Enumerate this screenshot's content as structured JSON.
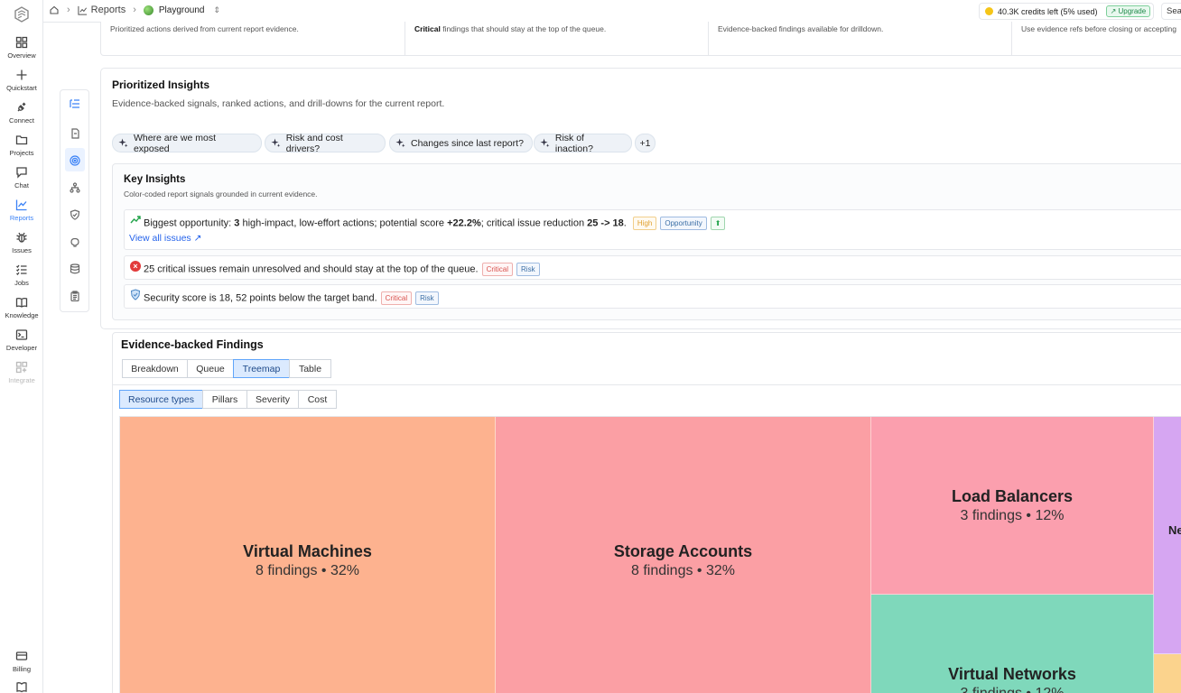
{
  "nav": {
    "items": [
      {
        "label": "Overview",
        "icon": "grid-icon"
      },
      {
        "label": "Quickstart",
        "icon": "plus-icon"
      },
      {
        "label": "Connect",
        "icon": "plug-icon"
      },
      {
        "label": "Projects",
        "icon": "folder-icon"
      },
      {
        "label": "Chat",
        "icon": "chat-icon"
      },
      {
        "label": "Reports",
        "icon": "chart-line-icon",
        "active": true
      },
      {
        "label": "Issues",
        "icon": "bug-icon"
      },
      {
        "label": "Jobs",
        "icon": "list-check-icon"
      },
      {
        "label": "Knowledge",
        "icon": "book-open-icon"
      },
      {
        "label": "Developer",
        "icon": "terminal-icon"
      },
      {
        "label": "Integrate",
        "icon": "puzzle-icon",
        "disabled": true
      }
    ],
    "bottom": [
      {
        "label": "Billing",
        "icon": "card-icon"
      },
      {
        "label": "",
        "icon": "book-icon"
      }
    ]
  },
  "topbar": {
    "reports_label": "Reports",
    "project_label": "Playground",
    "credits_text": "40.3K credits left (5% used)",
    "upgrade_label": "Upgrade",
    "search_label": "Sear"
  },
  "summary_strip": {
    "cells": [
      {
        "bold": "",
        "text": "Prioritized actions derived from current report evidence."
      },
      {
        "bold": "Critical",
        "text": " findings that should stay at the top of the queue."
      },
      {
        "bold": "",
        "text": "Evidence-backed findings available for drilldown."
      },
      {
        "bold": "",
        "text": "Use evidence refs before closing or accepting"
      }
    ]
  },
  "insights": {
    "title": "Prioritized Insights",
    "subtitle": "Evidence-backed signals, ranked actions, and drill-downs for the current report.",
    "chips": [
      "Where are we most exposed",
      "Risk and cost drivers?",
      "Changes since last report?",
      "Risk of inaction?"
    ],
    "more_chip": "+1",
    "key": {
      "title": "Key Insights",
      "subtitle": "Color-coded report signals grounded in current evidence.",
      "opportunity": {
        "p1": "Biggest opportunity: ",
        "b1": "3",
        "p2": " high-impact, low-effort actions; potential score ",
        "b2": "+22.2%",
        "p3": "; critical issue reduction ",
        "b3": "25 -> 18",
        "p4": ".",
        "badge_high": "High",
        "badge_opp": "Opportunity",
        "badge_up": "⬆",
        "link": "View all issues ↗"
      },
      "critical": {
        "text": "25 critical issues remain unresolved and should stay at the top of the queue.",
        "badge1": "Critical",
        "badge2": "Risk"
      },
      "security": {
        "text": "Security score is 18, 52 points below the target band.",
        "badge1": "Critical",
        "badge2": "Risk"
      }
    }
  },
  "findings": {
    "title": "Evidence-backed Findings",
    "view_tabs": [
      "Breakdown",
      "Queue",
      "Treemap",
      "Table"
    ],
    "active_view": "Treemap",
    "group_tabs": [
      "Resource types",
      "Pillars",
      "Severity",
      "Cost"
    ],
    "active_group": "Resource types",
    "treemap": [
      {
        "name": "Virtual Machines",
        "sub": "8 findings • 32%",
        "color": "#fdb28f"
      },
      {
        "name": "Storage Accounts",
        "sub": "8 findings • 32%",
        "color": "#fb9fa4"
      },
      {
        "name": "Load Balancers",
        "sub": "3 findings • 12%",
        "color": "#fb9fae"
      },
      {
        "name": "Virtual Networks",
        "sub": "3 findings • 12%",
        "color": "#7fd8bb"
      },
      {
        "name": "Ne",
        "sub": "",
        "color": "#d6a6f2"
      },
      {
        "name": "",
        "sub": "",
        "color": "#fbd38d"
      }
    ]
  }
}
